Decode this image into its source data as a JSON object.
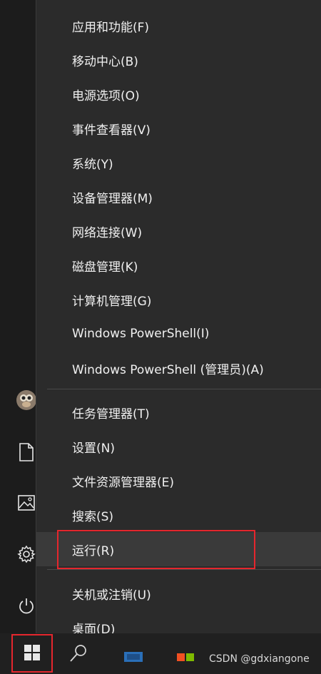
{
  "menu": {
    "items": [
      {
        "label": "应用和功能(F)"
      },
      {
        "label": "移动中心(B)"
      },
      {
        "label": "电源选项(O)"
      },
      {
        "label": "事件查看器(V)"
      },
      {
        "label": "系统(Y)"
      },
      {
        "label": "设备管理器(M)"
      },
      {
        "label": "网络连接(W)"
      },
      {
        "label": "磁盘管理(K)"
      },
      {
        "label": "计算机管理(G)"
      },
      {
        "label": "Windows PowerShell(I)"
      },
      {
        "label": "Windows PowerShell (管理员)(A)"
      },
      {
        "label": "任务管理器(T)"
      },
      {
        "label": "设置(N)"
      },
      {
        "label": "文件资源管理器(E)"
      },
      {
        "label": "搜索(S)"
      },
      {
        "label": "运行(R)"
      },
      {
        "label": "关机或注销(U)"
      },
      {
        "label": "桌面(D)"
      }
    ]
  },
  "icons": {
    "rail": [
      "avatar",
      "document-icon",
      "pictures-icon",
      "gear-icon",
      "power-icon"
    ],
    "taskbar": [
      "windows-start-icon",
      "search-icon",
      "app-icon",
      "store-icon"
    ]
  },
  "highlight_color": "#e5262d",
  "watermark": "CSDN @gdxiangone"
}
